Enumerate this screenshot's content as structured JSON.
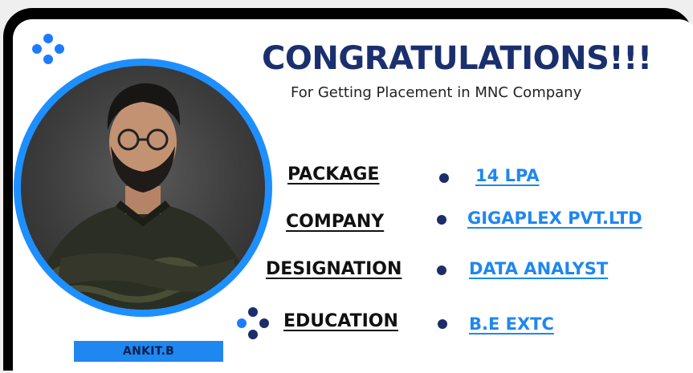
{
  "title": "CONGRATULATIONS!!!",
  "subtitle": "For Getting Placement in MNC Company",
  "name": "ANKIT.B",
  "details": [
    {
      "label": "PACKAGE",
      "value": "14 LPA"
    },
    {
      "label": "COMPANY",
      "value": "GIGAPLEX PVT.LTD"
    },
    {
      "label": "DESIGNATION",
      "value": "DATA ANALYST"
    },
    {
      "label": "EDUCATION",
      "value": "B.E EXTC"
    }
  ],
  "colors": {
    "accent": "#1f87f0",
    "navy": "#1a2f6e",
    "frame": "#000000"
  },
  "icons": {
    "top_decoration": "four-dot-cluster-icon",
    "education_decoration": "four-dot-cluster-icon",
    "bullet": "filled-circle-icon"
  }
}
